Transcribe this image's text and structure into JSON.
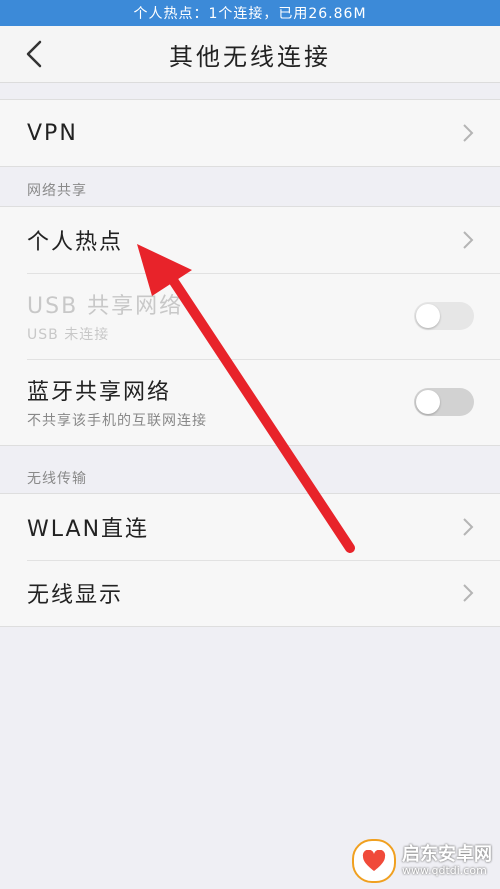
{
  "status_bar": {
    "text": "个人热点：1个连接，已用26.86M"
  },
  "header": {
    "title": "其他无线连接",
    "back_icon": "chevron-left-icon"
  },
  "groups": {
    "vpn": {
      "label": "VPN"
    },
    "sharing": {
      "header": "网络共享",
      "items": [
        {
          "label": "个人热点",
          "control": "chevron"
        },
        {
          "label": "USB 共享网络",
          "sub": "USB 未连接",
          "control": "toggle",
          "enabled": false,
          "on": false
        },
        {
          "label": "蓝牙共享网络",
          "sub": "不共享该手机的互联网连接",
          "control": "toggle",
          "enabled": true,
          "on": false
        }
      ]
    },
    "wireless": {
      "header": "无线传输",
      "items": [
        {
          "label": "WLAN直连",
          "control": "chevron"
        },
        {
          "label": "无线显示",
          "control": "chevron"
        }
      ]
    }
  },
  "watermark": {
    "title": "启东安卓网",
    "url": "www.qdtdi.com"
  },
  "colors": {
    "status_bar": "#3c8ad8",
    "background": "#efeff4",
    "annotation_arrow": "#e8232a",
    "toggle_off": "#d2d2d2"
  }
}
